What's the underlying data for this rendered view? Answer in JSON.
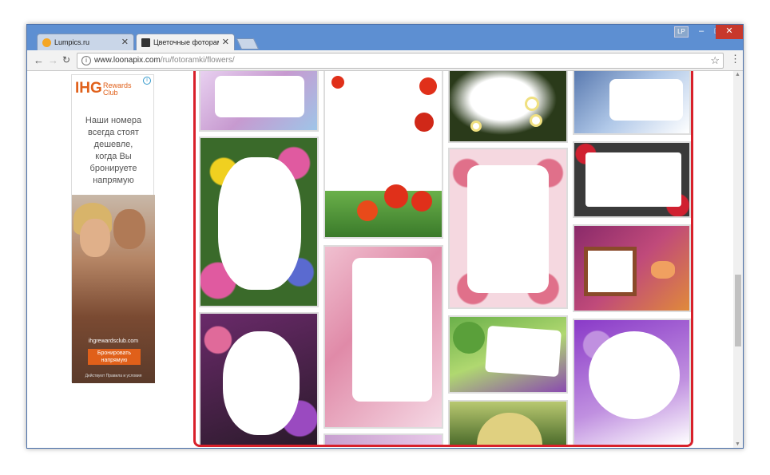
{
  "browser": {
    "tabs": [
      {
        "label": "Lumpics.ru",
        "favicon_color": "#f5a623"
      },
      {
        "label": "Цветочные фоторамки",
        "favicon_color": "#333333"
      }
    ],
    "profile_badge": "LP",
    "window_controls": {
      "minimize": "–",
      "maximize": "□",
      "close": "✕"
    },
    "address_bar": {
      "host": "www.loonapix.com",
      "path": "/ru/fotoramki/flowers/"
    },
    "nav": {
      "back": "←",
      "forward": "→",
      "reload": "C"
    },
    "star": "☆",
    "menu": "⋮"
  },
  "ad": {
    "brand": "IHG",
    "brand_sub_1": "Rewards",
    "brand_sub_2": "Club",
    "info_glyph": "i",
    "copy": [
      "Наши номера",
      "всегда стоят",
      "дешевле,",
      "когда Вы",
      "бронируете",
      "напрямую"
    ],
    "site": "ihgrewardsclub.com",
    "cta_line1": "Бронировать",
    "cta_line2": "напрямую",
    "fine_print": "Действуют Правила и условия",
    "accent": "#e0601a"
  },
  "gallery": {
    "highlight_color": "#d8202a",
    "frames": [
      {
        "name": "frame-purple-flowers-top",
        "palette": [
          "#c79ad0",
          "#9ec5e8",
          "#e8d0f0"
        ]
      },
      {
        "name": "frame-pansies",
        "palette": [
          "#3a6a2a",
          "#e05aa0",
          "#f0d020"
        ]
      },
      {
        "name": "frame-dark-roses",
        "palette": [
          "#6a2a6a",
          "#e06a9a",
          "#2a1a2a"
        ]
      },
      {
        "name": "frame-poppies",
        "palette": [
          "#ffffff",
          "#e0301a",
          "#6ab04a"
        ]
      },
      {
        "name": "frame-pink-orchids",
        "palette": [
          "#f0c0d0",
          "#e08aa8",
          "#ffffff"
        ]
      },
      {
        "name": "frame-daisies",
        "palette": [
          "#2a3a1a",
          "#ffffff",
          "#f0e080"
        ]
      },
      {
        "name": "frame-pink-roses",
        "palette": [
          "#f5d8e0",
          "#e0708a",
          "#7ab05a"
        ]
      },
      {
        "name": "frame-fairy-tree",
        "palette": [
          "#6ab04a",
          "#8a4ab0",
          "#f0e8a0"
        ]
      },
      {
        "name": "frame-green-bottom",
        "palette": [
          "#4a6a2a",
          "#b8c870",
          "#e0d080"
        ]
      },
      {
        "name": "frame-blue-flowers",
        "palette": [
          "#b0c8e8",
          "#5a7ab0",
          "#ffffff"
        ]
      },
      {
        "name": "frame-red-roses",
        "palette": [
          "#3a3a3a",
          "#d02030",
          "#ffffff"
        ]
      },
      {
        "name": "frame-butterfly-gold",
        "palette": [
          "#8a2a6a",
          "#e08a3a",
          "#6a2a2a"
        ]
      },
      {
        "name": "frame-violet-butterflies",
        "palette": [
          "#8a3ac8",
          "#c090e0",
          "#ffffff"
        ]
      }
    ]
  }
}
